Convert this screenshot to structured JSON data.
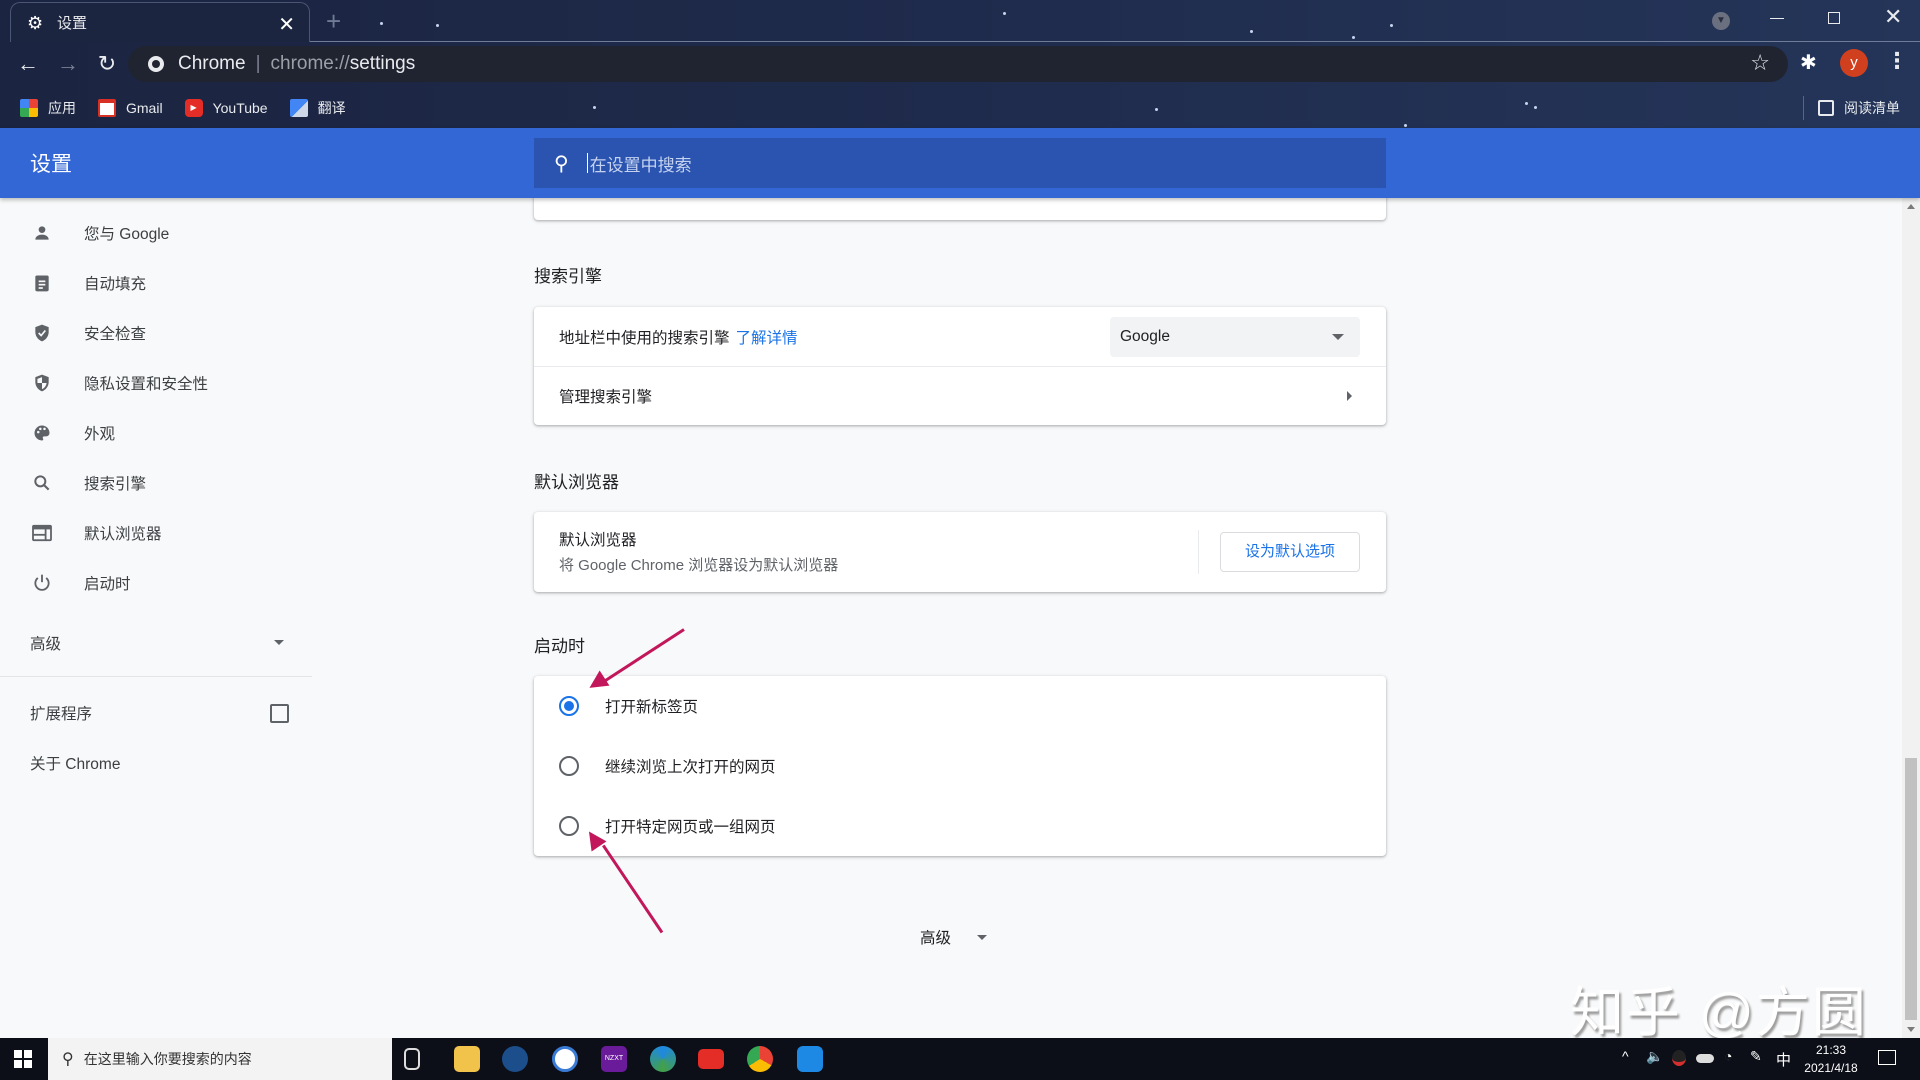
{
  "browser": {
    "tab": {
      "title": "设置",
      "icon": "gear-icon"
    },
    "new_tab_icon": "+",
    "omnibox": {
      "site_label": "Chrome",
      "url_scheme": "chrome://",
      "url_path": "settings"
    },
    "profile_initial": "y",
    "bookmarks": [
      {
        "label": "应用",
        "icon": "apps-grid-icon"
      },
      {
        "label": "Gmail",
        "icon": "gmail-icon"
      },
      {
        "label": "YouTube",
        "icon": "youtube-icon"
      },
      {
        "label": "翻译",
        "icon": "translate-icon"
      }
    ],
    "reading_list": "阅读清单"
  },
  "header": {
    "title": "设置",
    "search_placeholder": "在设置中搜索"
  },
  "sidebar": {
    "items": [
      {
        "label": "您与 Google",
        "icon": "person-icon"
      },
      {
        "label": "自动填充",
        "icon": "clipboard-icon"
      },
      {
        "label": "安全检查",
        "icon": "shield-check-icon"
      },
      {
        "label": "隐私设置和安全性",
        "icon": "shield-half-icon"
      },
      {
        "label": "外观",
        "icon": "palette-icon"
      },
      {
        "label": "搜索引擎",
        "icon": "search-icon"
      },
      {
        "label": "默认浏览器",
        "icon": "browser-icon"
      },
      {
        "label": "启动时",
        "icon": "power-icon"
      }
    ],
    "advanced": "高级",
    "extensions": "扩展程序",
    "about": "关于 Chrome"
  },
  "main": {
    "search_engine": {
      "title": "搜索引擎",
      "engine_label": "地址栏中使用的搜索引擎",
      "learn_more": "了解详情",
      "selected_engine": "Google",
      "manage": "管理搜索引擎"
    },
    "default_browser": {
      "title": "默认浏览器",
      "label": "默认浏览器",
      "description": "将 Google Chrome 浏览器设为默认浏览器",
      "button": "设为默认选项"
    },
    "on_startup": {
      "title": "启动时",
      "options": [
        {
          "label": "打开新标签页",
          "selected": true
        },
        {
          "label": "继续浏览上次打开的网页",
          "selected": false
        },
        {
          "label": "打开特定网页或一组网页",
          "selected": false
        }
      ]
    },
    "advanced_toggle": "高级"
  },
  "watermark": "知乎 @方圆",
  "taskbar": {
    "search_placeholder": "在这里输入你要搜索的内容",
    "ime": "中",
    "time": "21:33",
    "date": "2021/4/18"
  },
  "colors": {
    "accent": "#3367d6",
    "link": "#1a73e8",
    "annotation": "#c2185b"
  }
}
